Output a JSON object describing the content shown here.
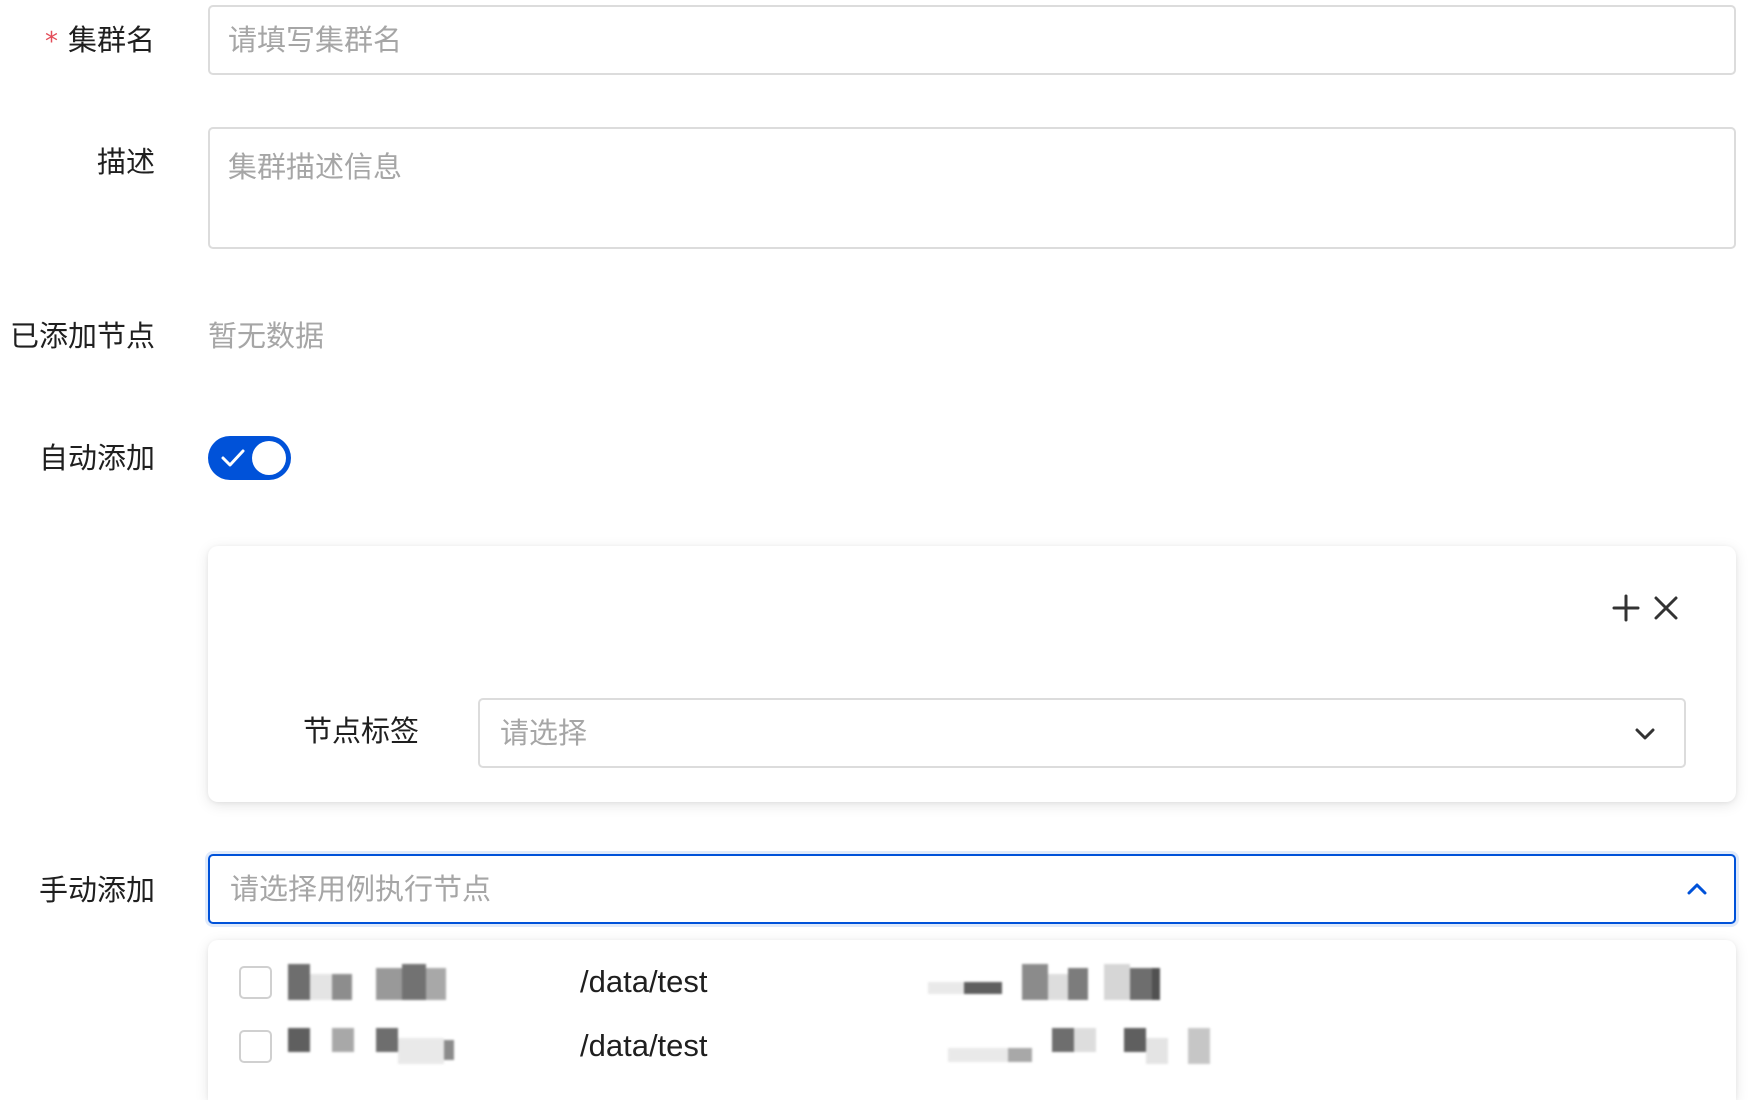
{
  "form": {
    "cluster_name": {
      "required_mark": "*",
      "label": "集群名",
      "placeholder": "请填写集群名",
      "value": ""
    },
    "description": {
      "label": "描述",
      "placeholder": "集群描述信息",
      "value": ""
    },
    "added_nodes": {
      "label": "已添加节点",
      "empty_text": "暂无数据"
    },
    "auto_add": {
      "label": "自动添加",
      "enabled": true
    },
    "tag_rule_card": {
      "add_icon": "plus-icon",
      "remove_icon": "close-icon",
      "node_tag": {
        "label": "节点标签",
        "placeholder": "请选择"
      }
    },
    "manual_add": {
      "label": "手动添加",
      "placeholder": "请选择用例执行节点",
      "expanded": true,
      "options": [
        {
          "path": "/data/test",
          "checked": false
        },
        {
          "path": "/data/test",
          "checked": false
        }
      ]
    }
  },
  "colors": {
    "primary": "#0052d9",
    "required": "#e34d59",
    "placeholder": "#a6a6a6",
    "border": "#dcdcdc"
  }
}
